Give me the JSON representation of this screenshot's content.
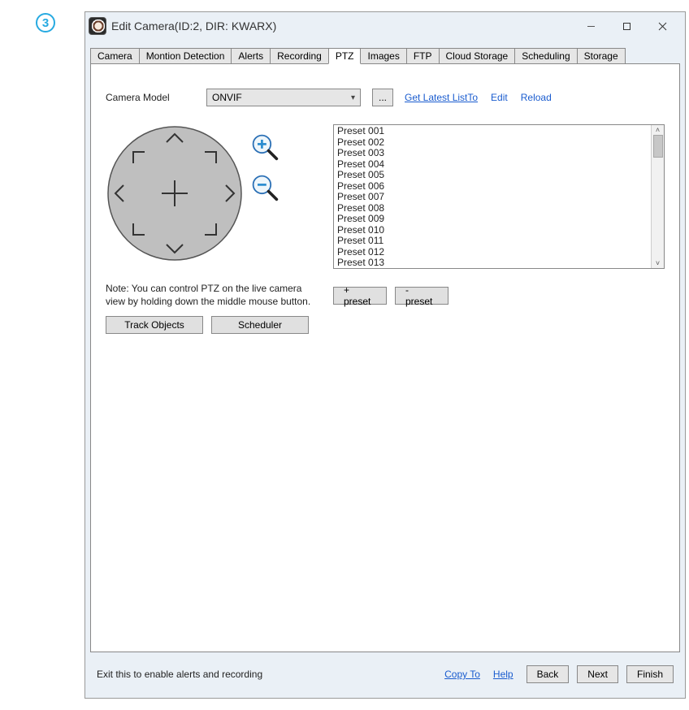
{
  "step_number": "3",
  "window": {
    "title": "Edit Camera(ID:2, DIR: KWARX)"
  },
  "tabs": [
    {
      "label": "Camera"
    },
    {
      "label": "Montion Detection"
    },
    {
      "label": "Alerts"
    },
    {
      "label": "Recording"
    },
    {
      "label": "PTZ"
    },
    {
      "label": "Images"
    },
    {
      "label": "FTP"
    },
    {
      "label": "Cloud Storage"
    },
    {
      "label": "Scheduling"
    },
    {
      "label": "Storage"
    }
  ],
  "active_tab_index": 4,
  "ptz": {
    "camera_model_label": "Camera Model",
    "camera_model_value": "ONVIF",
    "more_button": "...",
    "links": {
      "latest": "Get Latest ListTo",
      "edit": "Edit",
      "reload": "Reload"
    },
    "presets": [
      "Preset 001",
      "Preset 002",
      "Preset 003",
      "Preset 004",
      "Preset 005",
      "Preset 006",
      "Preset 007",
      "Preset 008",
      "Preset 009",
      "Preset 010",
      "Preset 011",
      "Preset 012",
      "Preset 013"
    ],
    "note": "Note: You can control PTZ on the live camera view by holding down the middle mouse button.",
    "track_objects_btn": "Track Objects",
    "scheduler_btn": "Scheduler",
    "add_preset_btn": "+ preset",
    "remove_preset_btn": "- preset"
  },
  "footer": {
    "hint": "Exit this to enable alerts and recording",
    "copy_to": "Copy To",
    "help": "Help",
    "back": "Back",
    "next": "Next",
    "finish": "Finish"
  }
}
